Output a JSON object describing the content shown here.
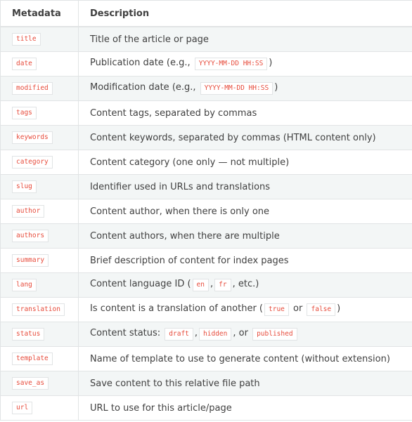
{
  "headers": {
    "metadata": "Metadata",
    "description": "Description"
  },
  "rows": [
    {
      "key": "title",
      "parts": [
        {
          "t": "Title of the article or page"
        }
      ]
    },
    {
      "key": "date",
      "parts": [
        {
          "t": "Publication date (e.g., "
        },
        {
          "c": "YYYY-MM-DD HH:SS"
        },
        {
          "t": ")"
        }
      ]
    },
    {
      "key": "modified",
      "parts": [
        {
          "t": "Modification date (e.g., "
        },
        {
          "c": "YYYY-MM-DD HH:SS"
        },
        {
          "t": ")"
        }
      ]
    },
    {
      "key": "tags",
      "parts": [
        {
          "t": "Content tags, separated by commas"
        }
      ]
    },
    {
      "key": "keywords",
      "parts": [
        {
          "t": "Content keywords, separated by commas (HTML content only)"
        }
      ]
    },
    {
      "key": "category",
      "parts": [
        {
          "t": "Content category (one only — not multiple)"
        }
      ]
    },
    {
      "key": "slug",
      "parts": [
        {
          "t": "Identifier used in URLs and translations"
        }
      ]
    },
    {
      "key": "author",
      "parts": [
        {
          "t": "Content author, when there is only one"
        }
      ]
    },
    {
      "key": "authors",
      "parts": [
        {
          "t": "Content authors, when there are multiple"
        }
      ]
    },
    {
      "key": "summary",
      "parts": [
        {
          "t": "Brief description of content for index pages"
        }
      ]
    },
    {
      "key": "lang",
      "parts": [
        {
          "t": "Content language ID ("
        },
        {
          "c": "en"
        },
        {
          "t": ","
        },
        {
          "c": "fr"
        },
        {
          "t": ", etc.)"
        }
      ]
    },
    {
      "key": "translation",
      "parts": [
        {
          "t": "Is content is a translation of another ("
        },
        {
          "c": "true"
        },
        {
          "t": " or "
        },
        {
          "c": "false"
        },
        {
          "t": ")"
        }
      ]
    },
    {
      "key": "status",
      "parts": [
        {
          "t": "Content status: "
        },
        {
          "c": "draft"
        },
        {
          "t": ","
        },
        {
          "c": "hidden"
        },
        {
          "t": ", or "
        },
        {
          "c": "published"
        }
      ]
    },
    {
      "key": "template",
      "parts": [
        {
          "t": "Name of template to use to generate content (without extension)"
        }
      ]
    },
    {
      "key": "save_as",
      "parts": [
        {
          "t": "Save content to this relative file path"
        }
      ]
    },
    {
      "key": "url",
      "parts": [
        {
          "t": "URL to use for this article/page"
        }
      ]
    }
  ]
}
